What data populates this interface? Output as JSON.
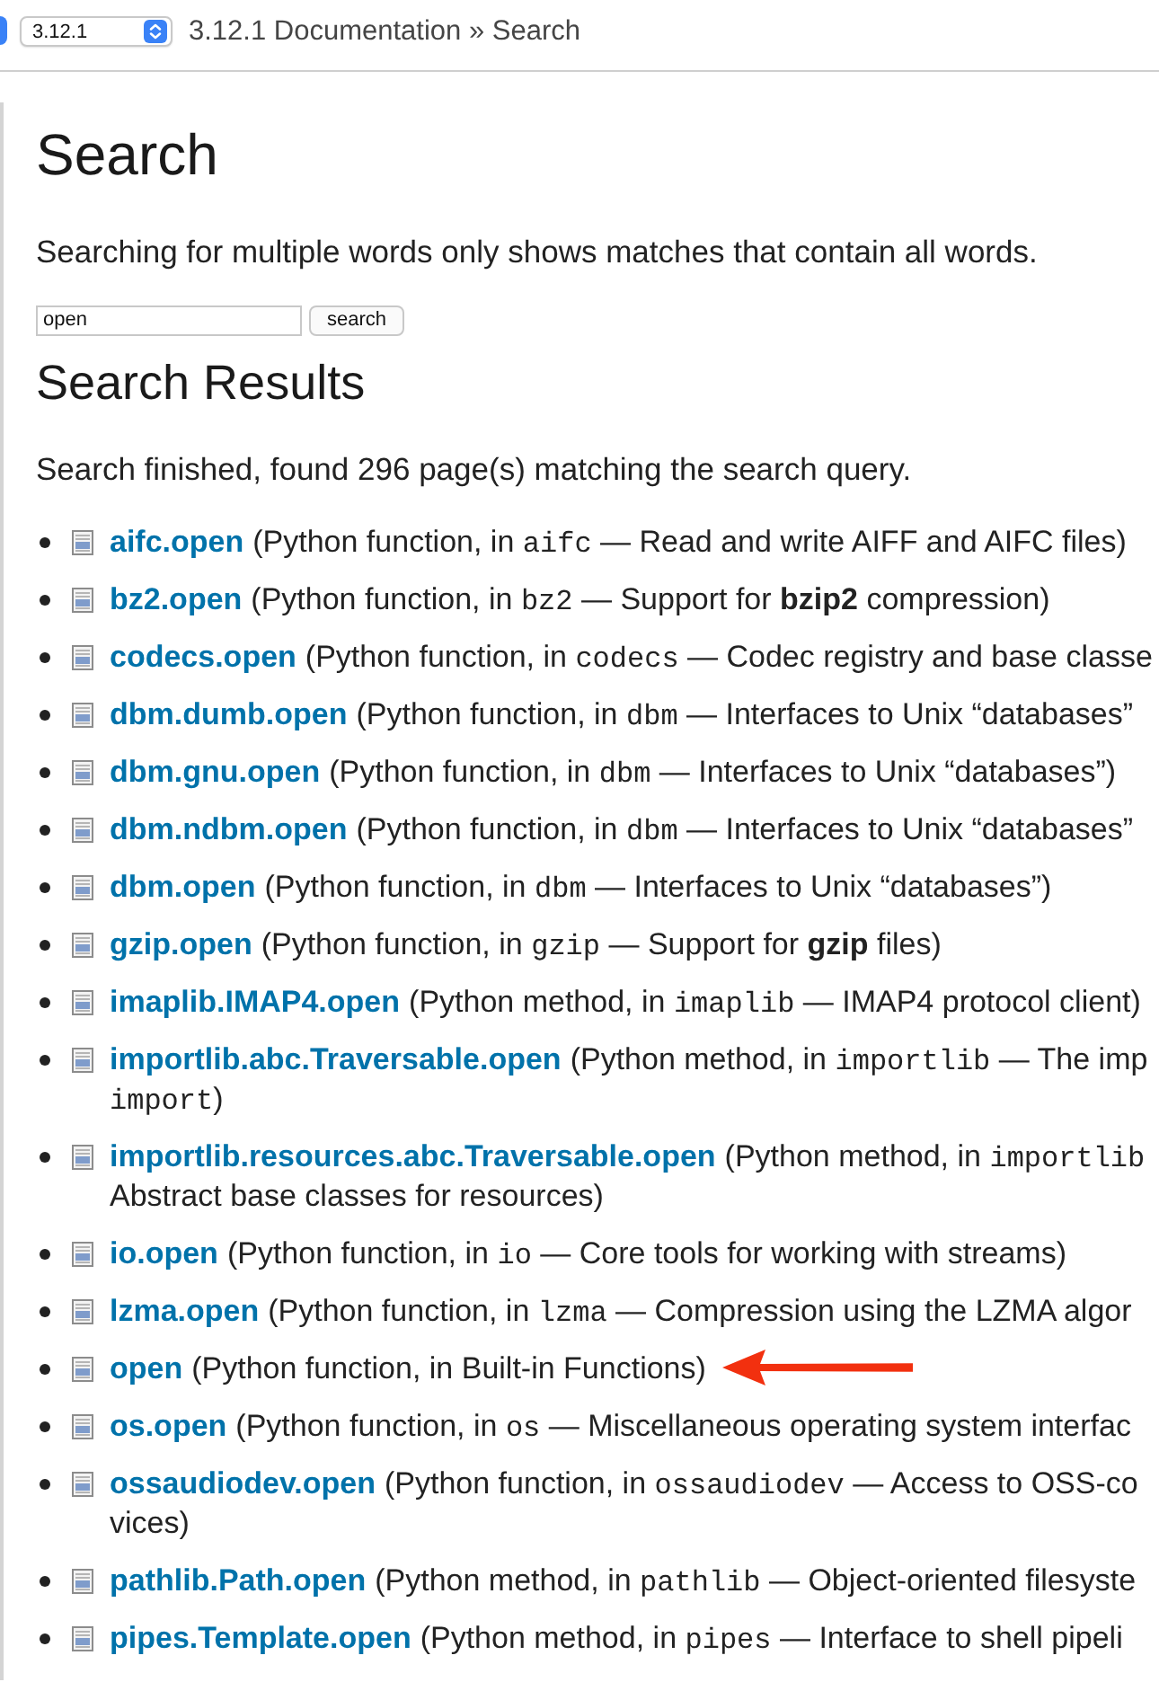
{
  "top_bar": {
    "version_select": {
      "value": "3.12.1"
    },
    "breadcrumb": "3.12.1 Documentation » Search"
  },
  "page": {
    "title": "Search",
    "hint": "Searching for multiple words only shows matches that contain all words.",
    "search_field": {
      "value": "open"
    },
    "search_button": "search",
    "results_title": "Search Results",
    "results_summary": "Search finished, found 296 page(s) matching the search query.",
    "results": [
      {
        "name": "aifc.open",
        "pointed_at": false,
        "description": [
          {
            "kind": "plain",
            "text": "(Python function, in "
          },
          {
            "kind": "code",
            "text": "aifc"
          },
          {
            "kind": "plain",
            "text": " — Read and write AIFF and AIFC files)"
          }
        ]
      },
      {
        "name": "bz2.open",
        "pointed_at": false,
        "description": [
          {
            "kind": "plain",
            "text": "(Python function, in "
          },
          {
            "kind": "code",
            "text": "bz2"
          },
          {
            "kind": "plain",
            "text": " — Support for **bzip2** compression)"
          }
        ]
      },
      {
        "name": "codecs.open",
        "pointed_at": false,
        "description": [
          {
            "kind": "plain",
            "text": "(Python function, in "
          },
          {
            "kind": "code",
            "text": "codecs"
          },
          {
            "kind": "plain",
            "text": " — Codec registry and base classe"
          }
        ]
      },
      {
        "name": "dbm.dumb.open",
        "pointed_at": false,
        "description": [
          {
            "kind": "plain",
            "text": "(Python function, in "
          },
          {
            "kind": "code",
            "text": "dbm"
          },
          {
            "kind": "plain",
            "text": " — Interfaces to Unix “databases”"
          }
        ]
      },
      {
        "name": "dbm.gnu.open",
        "pointed_at": false,
        "description": [
          {
            "kind": "plain",
            "text": "(Python function, in "
          },
          {
            "kind": "code",
            "text": "dbm"
          },
          {
            "kind": "plain",
            "text": " — Interfaces to Unix “databases”)"
          }
        ]
      },
      {
        "name": "dbm.ndbm.open",
        "pointed_at": false,
        "description": [
          {
            "kind": "plain",
            "text": "(Python function, in "
          },
          {
            "kind": "code",
            "text": "dbm"
          },
          {
            "kind": "plain",
            "text": " — Interfaces to Unix “databases”"
          }
        ]
      },
      {
        "name": "dbm.open",
        "pointed_at": false,
        "description": [
          {
            "kind": "plain",
            "text": "(Python function, in "
          },
          {
            "kind": "code",
            "text": "dbm"
          },
          {
            "kind": "plain",
            "text": " — Interfaces to Unix “databases”)"
          }
        ]
      },
      {
        "name": "gzip.open",
        "pointed_at": false,
        "description": [
          {
            "kind": "plain",
            "text": "(Python function, in "
          },
          {
            "kind": "code",
            "text": "gzip"
          },
          {
            "kind": "plain",
            "text": " — Support for **gzip** files)"
          }
        ]
      },
      {
        "name": "imaplib.IMAP4.open",
        "pointed_at": false,
        "description": [
          {
            "kind": "plain",
            "text": "(Python method, in "
          },
          {
            "kind": "code",
            "text": "imaplib"
          },
          {
            "kind": "plain",
            "text": " — IMAP4 protocol client)"
          }
        ]
      },
      {
        "name": "importlib.abc.Traversable.open",
        "pointed_at": false,
        "description": [
          {
            "kind": "plain",
            "text": "(Python method, in "
          },
          {
            "kind": "code",
            "text": "importlib"
          },
          {
            "kind": "plain",
            "text": " — The imp"
          }
        ],
        "continuation": [
          {
            "kind": "code",
            "text": "import"
          },
          {
            "kind": "plain",
            "text": ")"
          }
        ]
      },
      {
        "name": "importlib.resources.abc.Traversable.open",
        "pointed_at": false,
        "description": [
          {
            "kind": "plain",
            "text": "(Python method, in "
          },
          {
            "kind": "code",
            "text": "importlib"
          }
        ],
        "continuation": [
          {
            "kind": "plain",
            "text": "Abstract base classes for resources)"
          }
        ]
      },
      {
        "name": "io.open",
        "pointed_at": false,
        "description": [
          {
            "kind": "plain",
            "text": "(Python function, in "
          },
          {
            "kind": "code",
            "text": "io"
          },
          {
            "kind": "plain",
            "text": " — Core tools for working with streams)"
          }
        ]
      },
      {
        "name": "lzma.open",
        "pointed_at": false,
        "description": [
          {
            "kind": "plain",
            "text": "(Python function, in "
          },
          {
            "kind": "code",
            "text": "lzma"
          },
          {
            "kind": "plain",
            "text": " — Compression using the LZMA algor"
          }
        ]
      },
      {
        "name": "open",
        "pointed_at": true,
        "description": [
          {
            "kind": "plain",
            "text": "(Python function, in Built-in Functions)"
          }
        ]
      },
      {
        "name": "os.open",
        "pointed_at": false,
        "description": [
          {
            "kind": "plain",
            "text": "(Python function, in "
          },
          {
            "kind": "code",
            "text": "os"
          },
          {
            "kind": "plain",
            "text": " — Miscellaneous operating system interfac"
          }
        ]
      },
      {
        "name": "ossaudiodev.open",
        "pointed_at": false,
        "description": [
          {
            "kind": "plain",
            "text": "(Python function, in "
          },
          {
            "kind": "code",
            "text": "ossaudiodev"
          },
          {
            "kind": "plain",
            "text": " — Access to OSS-co"
          }
        ],
        "continuation": [
          {
            "kind": "plain",
            "text": "vices)"
          }
        ]
      },
      {
        "name": "pathlib.Path.open",
        "pointed_at": false,
        "description": [
          {
            "kind": "plain",
            "text": "(Python method, in "
          },
          {
            "kind": "code",
            "text": "pathlib"
          },
          {
            "kind": "plain",
            "text": " — Object-oriented filesyste"
          }
        ]
      },
      {
        "name": "pipes.Template.open",
        "pointed_at": false,
        "description": [
          {
            "kind": "plain",
            "text": "(Python method, in "
          },
          {
            "kind": "code",
            "text": "pipes"
          },
          {
            "kind": "plain",
            "text": " — Interface to shell pipeli"
          }
        ]
      }
    ]
  }
}
